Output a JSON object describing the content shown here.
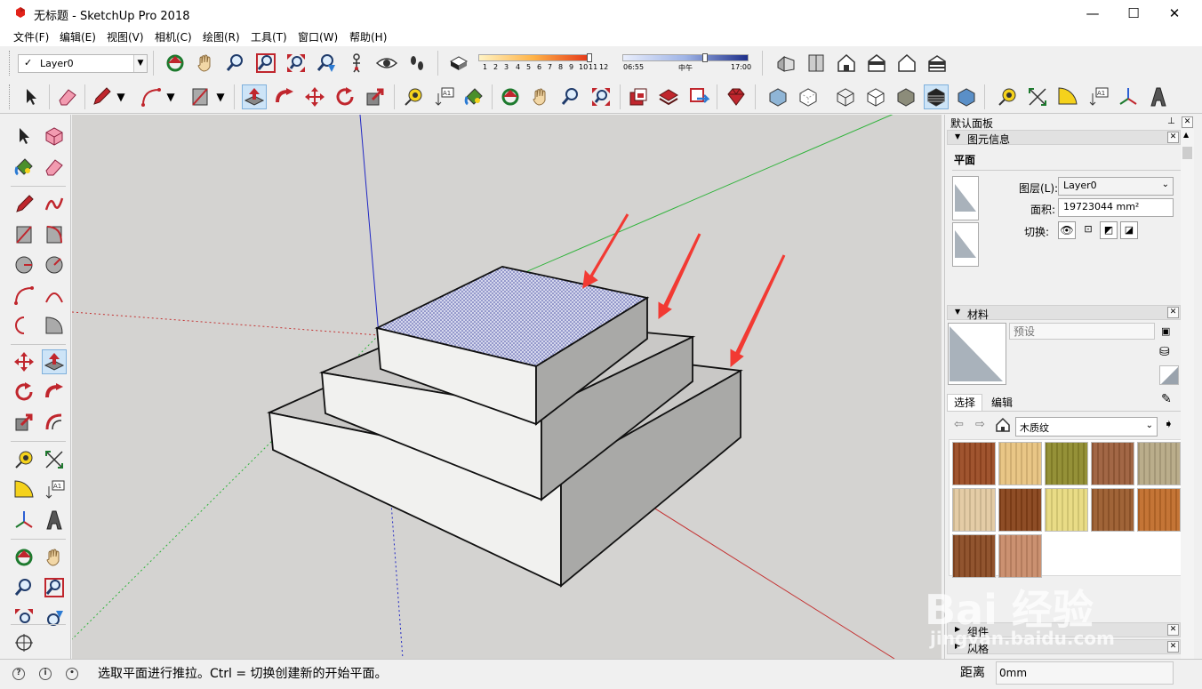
{
  "window": {
    "title": "无标题 - SketchUp Pro 2018",
    "minimize": "—",
    "maximize": "☐",
    "close": "✕"
  },
  "menu": [
    "文件(F)",
    "编辑(E)",
    "视图(V)",
    "相机(C)",
    "绘图(R)",
    "工具(T)",
    "窗口(W)",
    "帮助(H)"
  ],
  "layers_toolbar": {
    "current_layer": "Layer0"
  },
  "shadow": {
    "month_ticks": [
      "1",
      "2",
      "3",
      "4",
      "5",
      "6",
      "7",
      "8",
      "9",
      "10",
      "11",
      "12"
    ],
    "time_start": "06:55",
    "time_noon": "中午",
    "time_end": "17:00"
  },
  "default_tray": {
    "title": "默认面板",
    "entity_info": {
      "header": "图元信息",
      "entity_type": "平面",
      "layer_label": "图层(L):",
      "layer_value": "Layer0",
      "area_label": "面积:",
      "area_value": "19723044 mm²",
      "toggles_label": "切换:"
    },
    "materials": {
      "header": "材料",
      "name_placeholder": "预设",
      "tabs": [
        "选择",
        "编辑"
      ],
      "collection": "木质纹",
      "swatch_colors": [
        "#9a4a22",
        "#e8c27e",
        "#8e8a2c",
        "#9c5e3a",
        "#b6a884",
        "#e2c9a0",
        "#874218",
        "#e8da7e",
        "#9a5a2c",
        "#c06c2a",
        "#8a4a22",
        "#c88a68"
      ]
    },
    "components": {
      "header": "组件"
    },
    "styles": {
      "header": "风格"
    }
  },
  "status": {
    "message": "选取平面进行推拉。Ctrl = 切换创建新的开始平面。",
    "measure_label": "距离",
    "measure_value": "0mm"
  },
  "watermark": {
    "brand": "Bai 经验",
    "url": "jingyan.baidu.com"
  }
}
